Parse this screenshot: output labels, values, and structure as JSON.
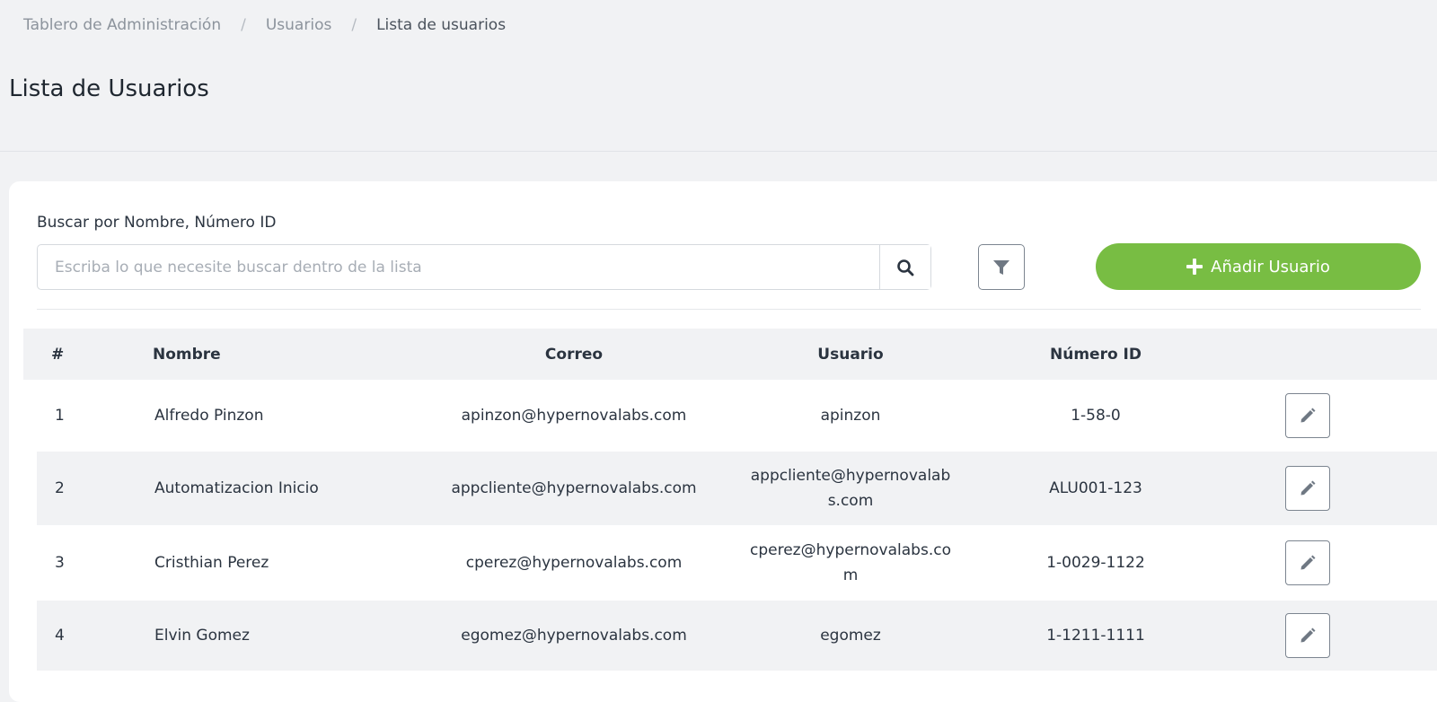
{
  "breadcrumb": {
    "items": [
      "Tablero de Administración",
      "Usuarios",
      "Lista de usuarios"
    ],
    "separator": "/"
  },
  "page": {
    "title": "Lista de Usuarios"
  },
  "search": {
    "label": "Buscar por Nombre, Número ID",
    "placeholder": "Escriba lo que necesite buscar dentro de la lista",
    "value": "",
    "button_icon": "search-icon"
  },
  "toolbar": {
    "filter_icon": "filter-icon",
    "add_label": "Añadir Usuario",
    "add_icon": "plus-icon",
    "accent_color": "#78bd43"
  },
  "table": {
    "columns": [
      "#",
      "Nombre",
      "Correo",
      "Usuario",
      "Número ID"
    ],
    "rows": [
      {
        "index": "1",
        "name": "Alfredo Pinzon",
        "email": "apinzon@hypernovalabs.com",
        "user_line1": "apinzon",
        "user_line2": "",
        "id": "1-58-0"
      },
      {
        "index": "2",
        "name": "Automatizacion Inicio",
        "email": "appcliente@hypernovalabs.com",
        "user_line1": "appcliente@hypernovalab",
        "user_line2": "s.com",
        "id": "ALU001-123"
      },
      {
        "index": "3",
        "name": "Cristhian Perez",
        "email": "cperez@hypernovalabs.com",
        "user_line1": "cperez@hypernovalabs.co",
        "user_line2": "m",
        "id": "1-0029-1122"
      },
      {
        "index": "4",
        "name": "Elvin Gomez",
        "email": "egomez@hypernovalabs.com",
        "user_line1": "egomez",
        "user_line2": "",
        "id": "1-1211-1111"
      }
    ],
    "row_action_icon": "pencil-icon"
  }
}
